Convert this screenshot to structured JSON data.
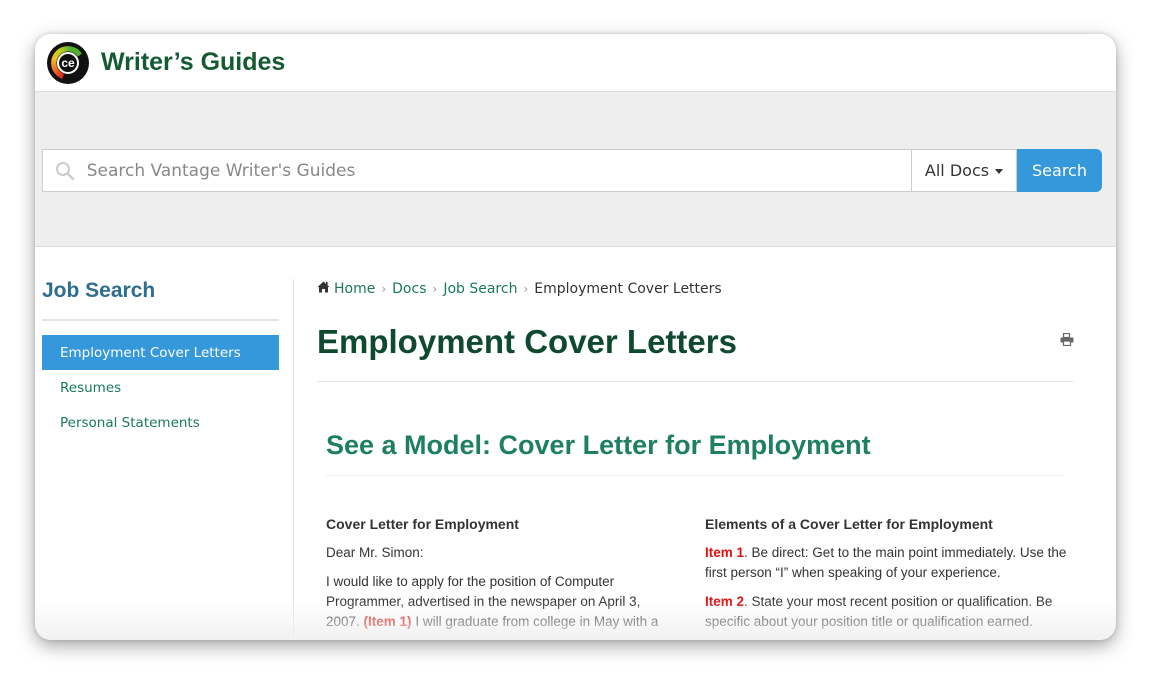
{
  "header": {
    "brand": "Writer’s Guides",
    "logo_text": "ce"
  },
  "search": {
    "placeholder": "Search Vantage Writer's Guides",
    "value": "",
    "scope_label": "All Docs",
    "button_label": "Search"
  },
  "sidebar": {
    "title": "Job Search",
    "items": [
      {
        "label": "Employment Cover Letters",
        "active": true
      },
      {
        "label": "Resumes",
        "active": false
      },
      {
        "label": "Personal Statements",
        "active": false
      }
    ]
  },
  "breadcrumb": {
    "items": [
      "Home",
      "Docs",
      "Job Search"
    ],
    "current": "Employment Cover Letters"
  },
  "page": {
    "title": "Employment Cover Letters",
    "section_title": "See a Model: Cover Letter for Employment"
  },
  "model_letter": {
    "heading": "Cover Letter for Employment",
    "salutation": "Dear Mr. Simon:",
    "para1_before": "I would like to apply for the position of Computer Programmer, advertised in the newspaper on April 3, 2007. ",
    "para1_marker": "(Item 1)",
    "para1_after": " I will graduate from college in May with a"
  },
  "elements": {
    "heading": "Elements of a Cover Letter for Employment",
    "items": [
      {
        "label": "Item 1",
        "text": ". Be direct: Get to the main point immediately. Use the first person “I” when speaking of your experience."
      },
      {
        "label": "Item 2",
        "text": ". State your most recent position or qualification. Be specific about your position title or qualification earned."
      }
    ]
  },
  "colors": {
    "brand_green": "#145a32",
    "accent_blue": "#3498db",
    "link_green": "#1a7a5a",
    "marker_red": "#e01010"
  }
}
